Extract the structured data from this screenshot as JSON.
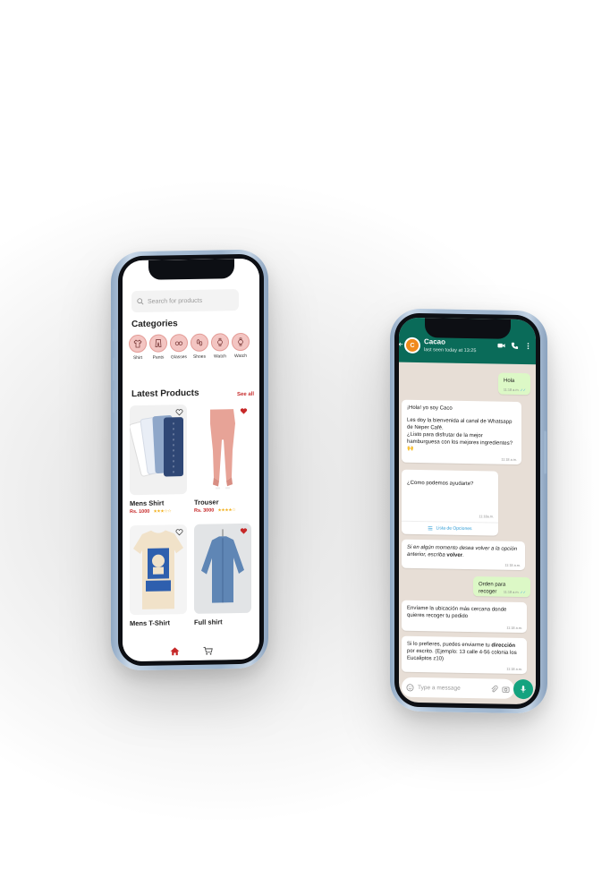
{
  "colors": {
    "brand_red": "#c62828",
    "category_pink": "#f3c5c2",
    "whatsapp_green": "#0a6b59",
    "bubble_out": "#dcf8c6",
    "mic_green": "#14a37f"
  },
  "shop": {
    "search_placeholder": "Search for products",
    "categories_title": "Categories",
    "categories": [
      {
        "label": "Shirt",
        "icon": "shirt-icon"
      },
      {
        "label": "Pants",
        "icon": "pants-icon"
      },
      {
        "label": "Glasses",
        "icon": "glasses-icon"
      },
      {
        "label": "Shoes",
        "icon": "shoes-icon"
      },
      {
        "label": "Watch",
        "icon": "watch-icon"
      },
      {
        "label": "Watch",
        "icon": "watch-icon"
      }
    ],
    "latest_title": "Latest Products",
    "see_all": "See all",
    "products": [
      {
        "name": "Mens Shirt",
        "price": "Rs. 1000",
        "rating": 3,
        "favorite": false
      },
      {
        "name": "Trouser",
        "price": "Rs. 3000",
        "rating": 4,
        "favorite": true
      },
      {
        "name": "Mens T-Shirt",
        "price": "",
        "rating": null,
        "favorite": false
      },
      {
        "name": "Full shirt",
        "price": "",
        "rating": null,
        "favorite": true
      }
    ],
    "nav": [
      {
        "icon": "home-icon",
        "active": true
      },
      {
        "icon": "cart-icon",
        "active": false
      }
    ]
  },
  "chat": {
    "contact_name": "Cacao",
    "contact_status": "last seen today at 13:25",
    "avatar_letter": "C",
    "messages": [
      {
        "dir": "out",
        "text": "Hola",
        "time": "11:18 a.m."
      },
      {
        "dir": "in",
        "line1": "¡Hola! yo soy Caco",
        "line2": "Les doy la bienvenida al canal de Whatsapp de Neper Café.",
        "line3": "¿Listo para disfrutar de la mejor hamburguesa con los mejores ingredientes? 🙌",
        "time": "11:18 a.m."
      },
      {
        "dir": "in",
        "text": "¿Como podemos ayudarte?",
        "time": "11:18a.m.",
        "button": "Lista de Opciones"
      },
      {
        "dir": "in",
        "part1": "Si en algún momento desea volver a la opción anterior, escriba ",
        "bold": "volver",
        "part2": ".",
        "time": "11:18 a.m."
      },
      {
        "dir": "out",
        "text": "Orden para recoger",
        "time": "11:18 a.m."
      },
      {
        "dir": "in",
        "text": "Envíame la ubicación más cercana donde quieres recoger tu pedido",
        "time": "11:18 a.m."
      },
      {
        "dir": "in",
        "part1": "Si lo prefieres, puedes enviarme tu ",
        "bold": "dirección",
        "part2": " por escrito. (Ejemplo: 13 calle 4-56 colonia los Eucaliptos z10)",
        "time": "11:18 a.m."
      }
    ],
    "input_placeholder": "Type a message"
  }
}
